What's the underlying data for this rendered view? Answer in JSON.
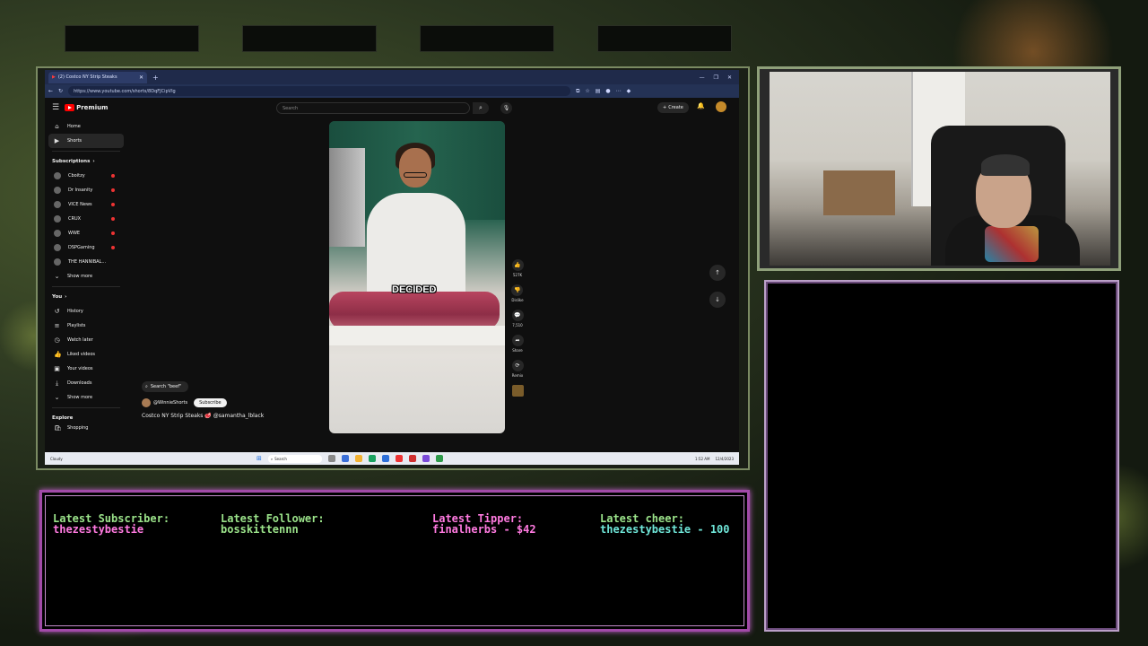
{
  "browser": {
    "tab_title": "(2) Costco NY Strip Steaks",
    "url": "https://www.youtube.com/shorts/8DqFJCipVIg"
  },
  "youtube": {
    "logo_text": "Premium",
    "search_placeholder": "Search",
    "create_label": "Create",
    "sidebar": {
      "home": "Home",
      "shorts": "Shorts",
      "subscriptions_heading": "Subscriptions",
      "subscriptions": [
        "Cboitzy",
        "Dr Insanity",
        "VICE News",
        "CRUX",
        "WWE",
        "DSPGaming",
        "THE HANNIBAL..."
      ],
      "show_more_1": "Show more",
      "you_heading": "You",
      "you_items": [
        "History",
        "Playlists",
        "Watch later",
        "Liked videos",
        "Your videos",
        "Downloads"
      ],
      "show_more_2": "Show more",
      "explore_heading": "Explore",
      "shopping": "Shopping"
    },
    "short": {
      "caption": "DECIDED",
      "search_chip": "Search \"beef\"",
      "channel": "@WinnieShorts",
      "subscribe": "Subscribe",
      "title": "Costco NY Strip Steaks 🥩 @samantha_lblack",
      "likes": "527K",
      "dislike": "Dislike",
      "comments": "7,510",
      "share": "Share",
      "remix": "Remix"
    }
  },
  "taskbar": {
    "search": "Search",
    "weather_label": "Cloudy",
    "clock_time": "1:52 AM",
    "clock_date": "12/4/2023"
  },
  "alerts": {
    "subscriber_label": "Latest Subscriber:",
    "subscriber_name": "thezestybestie",
    "follower_label": "Latest Follower:",
    "follower_name": "bosskittennn",
    "tipper_label": "Latest Tipper:",
    "tipper_value": "finalherbs - $42",
    "cheer_label": "Latest cheer:",
    "cheer_value": "thezestybestie - 100"
  },
  "colors": {
    "frame_pink": "#a24aa8",
    "frame_green": "#8fa07a",
    "yt_red": "#ff0000",
    "alert_green": "#9be38a",
    "alert_pink": "#ff7ae0"
  }
}
